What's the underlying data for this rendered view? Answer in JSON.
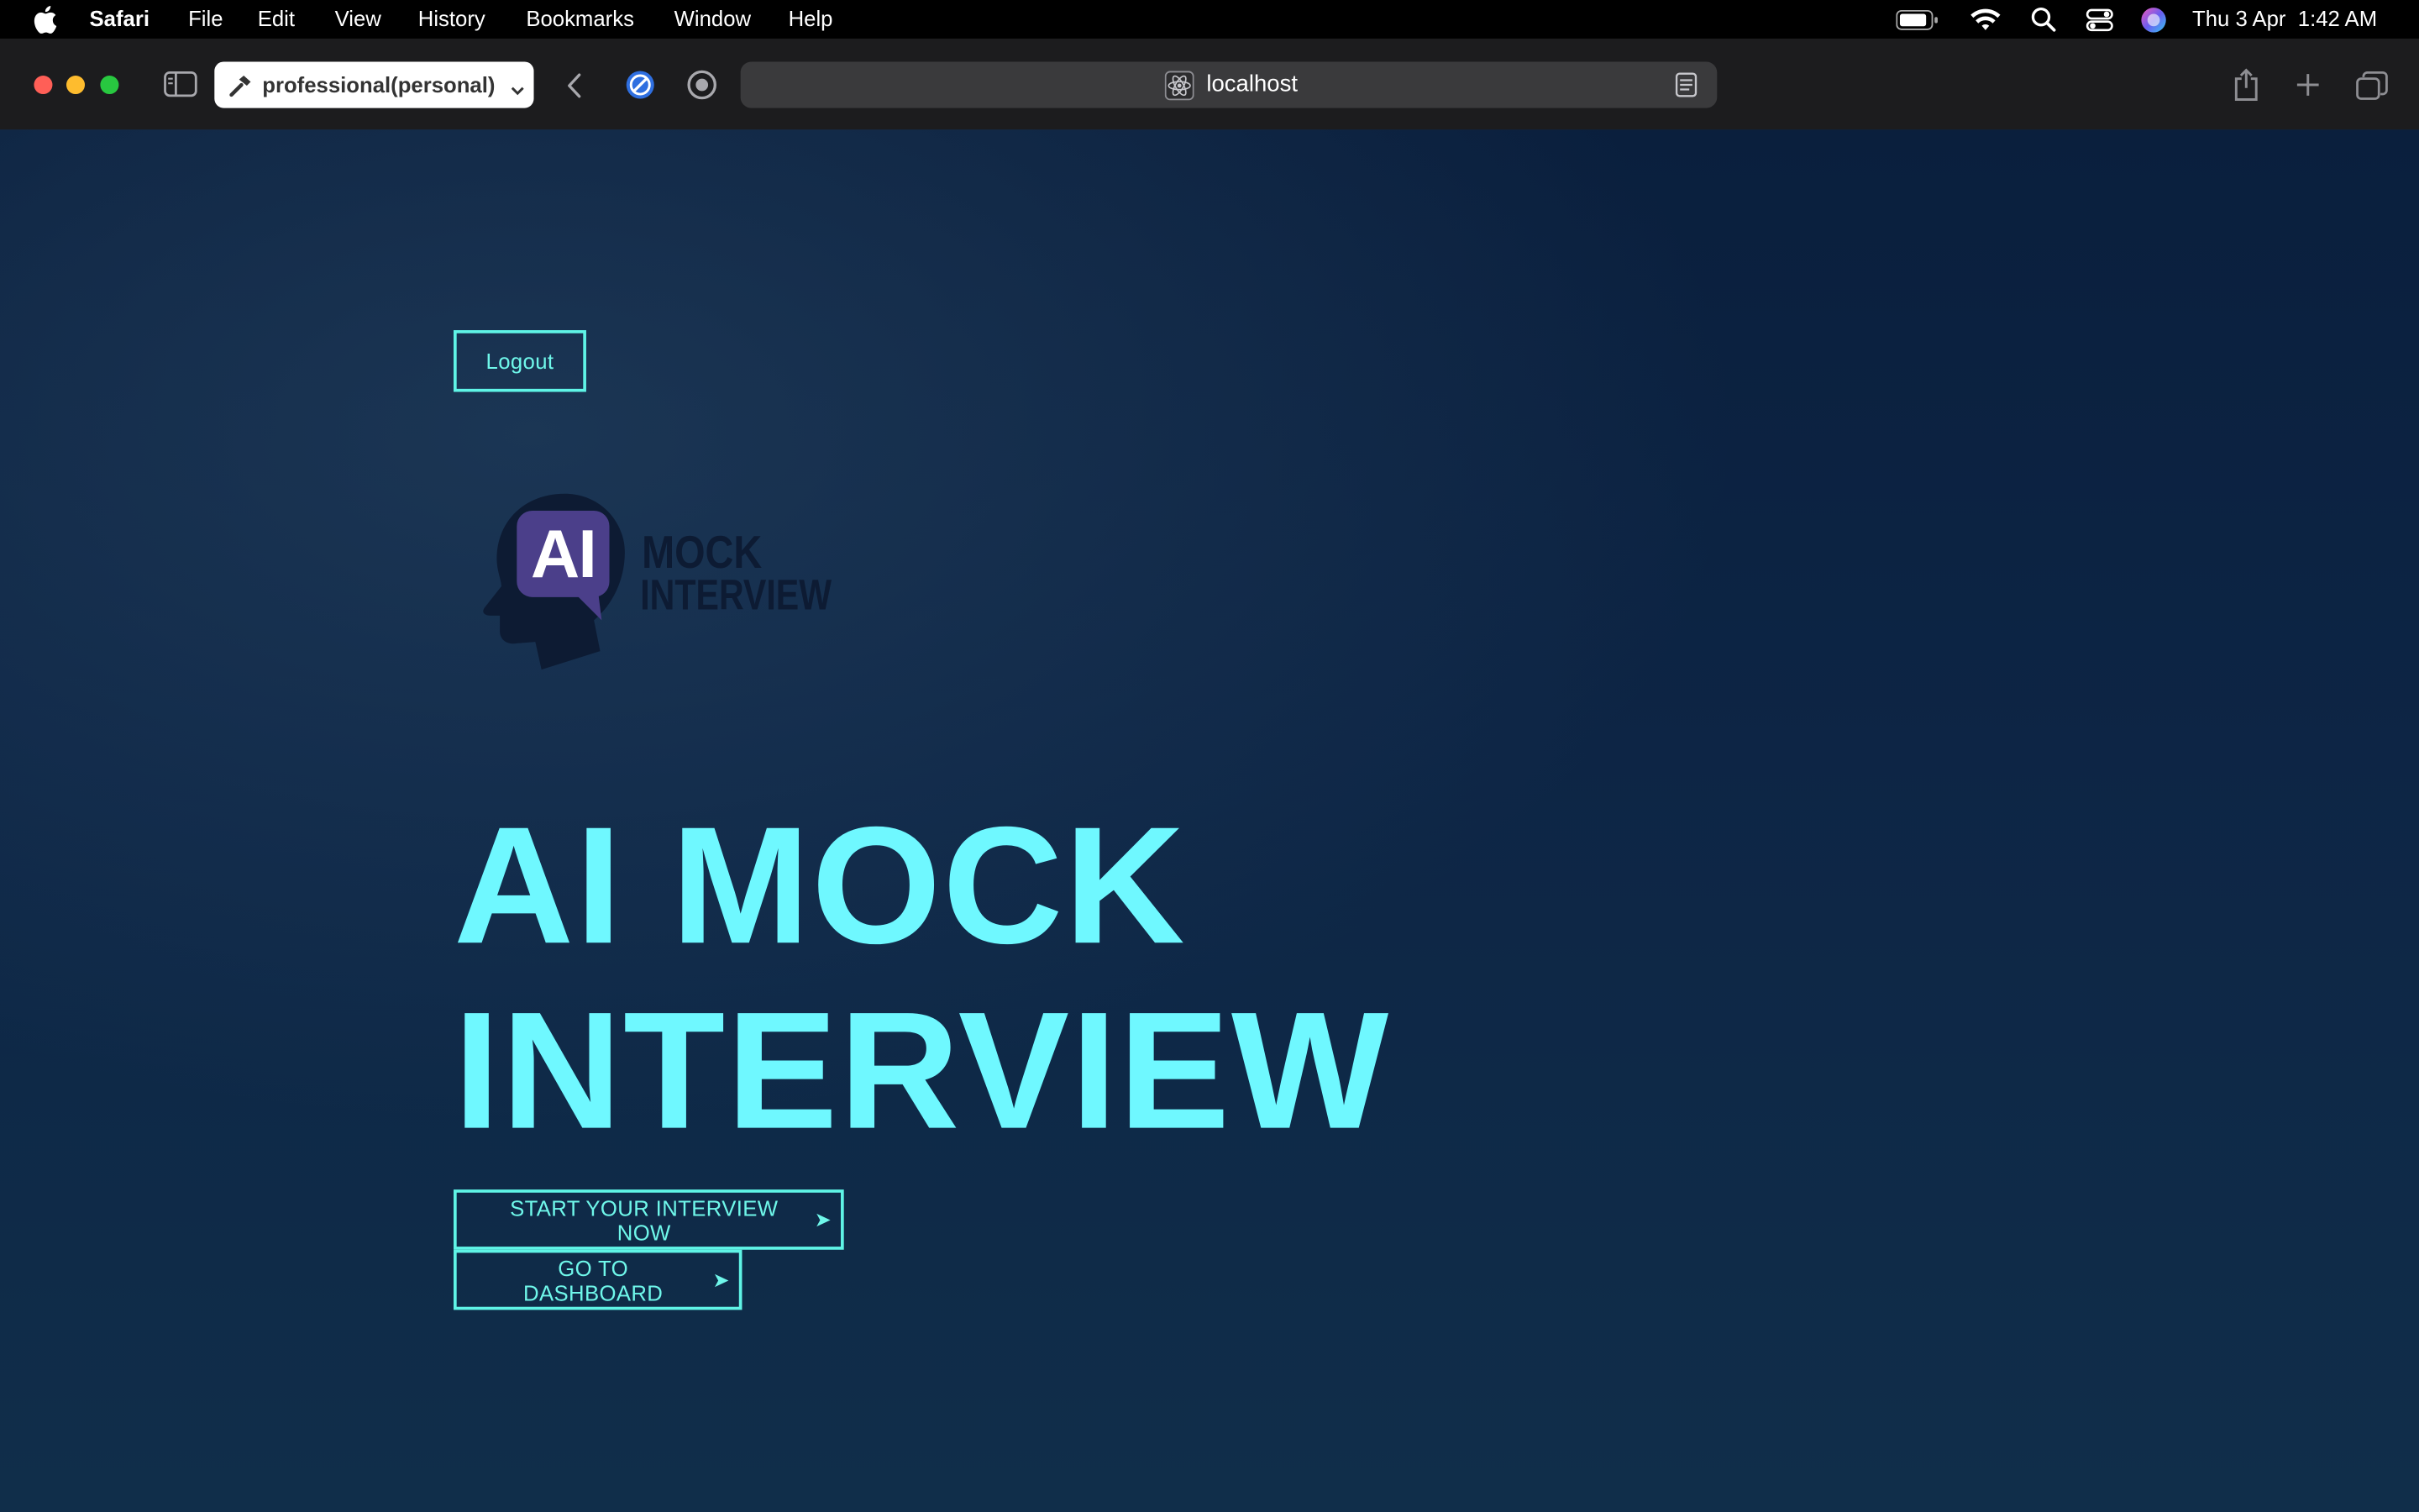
{
  "menubar": {
    "app_name": "Safari",
    "items": [
      "File",
      "Edit",
      "View",
      "History",
      "Bookmarks",
      "Window",
      "Help"
    ],
    "datetime": "Thu 3 Apr  1:42 AM"
  },
  "toolbar": {
    "profile_label": "professional(personal)",
    "address": "localhost"
  },
  "page": {
    "logout_label": "Logout",
    "logo": {
      "badge": "AI",
      "line1": "MOCK",
      "line2": "INTERVIEW"
    },
    "hero_line1": "AI MOCK",
    "hero_line2": "INTERVIEW",
    "start_label": "START YOUR INTERVIEW NOW",
    "dashboard_label": "GO TO DASHBOARD",
    "arrow": "➤"
  },
  "colors": {
    "accent": "#6ff8ff",
    "button_border": "#5ff4e6",
    "background_top": "#0a1f3d",
    "background_bottom": "#102e4a",
    "logo_badge": "#4b3f8a",
    "logo_dark": "#0d1b33"
  }
}
